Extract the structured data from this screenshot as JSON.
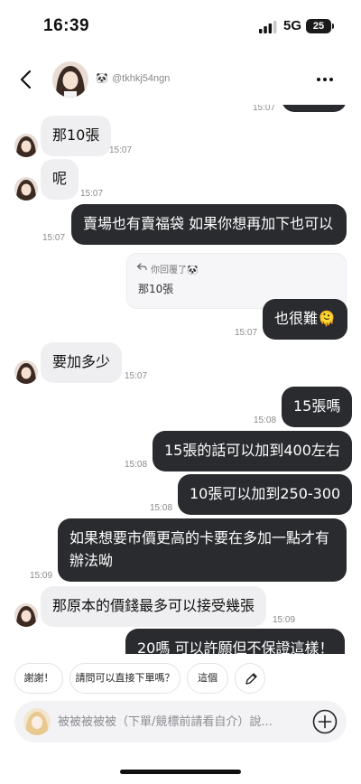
{
  "status_bar": {
    "time": "16:39",
    "network": "5G",
    "battery": "25"
  },
  "header": {
    "emoji": "🐼",
    "username": "@tkhkj54ngn"
  },
  "chat": {
    "top_ts": "15:07",
    "m1": {
      "text": "那10張",
      "time": "15:07"
    },
    "m2": {
      "text": "呢",
      "time": "15:07"
    },
    "m3": {
      "text": "賣場也有賣福袋 如果你想再加下也可以",
      "time": "15:07"
    },
    "reply": {
      "label": "你回覆了🐼",
      "quoted": "那10張"
    },
    "m4": {
      "text": "也很難🫠",
      "time": "15:07"
    },
    "m5": {
      "text": "要加多少",
      "time": "15:07"
    },
    "m6": {
      "text": "15張嗎",
      "time": "15:08"
    },
    "m7": {
      "text": "15張的話可以加到400左右",
      "time": "15:08"
    },
    "m8": {
      "text": "10張可以加到250-300",
      "time": "15:08"
    },
    "m9": {
      "text": "如果想要市價更高的卡要在多加一點才有辦法呦",
      "time": "15:09"
    },
    "m10": {
      "text": "那原本的價錢最多可以接受幾張",
      "time": "15:09"
    },
    "m11": {
      "text": "20嗎 可以許願但不保證這樣！"
    }
  },
  "quick_replies": [
    "謝謝！",
    "請問可以直接下單嗎？",
    "這個"
  ],
  "composer": {
    "placeholder": "被被被被被（下單/競標前請看自介）說..."
  },
  "colors": {
    "outgoing": "#2a2b2f",
    "incoming": "#efeff1"
  }
}
